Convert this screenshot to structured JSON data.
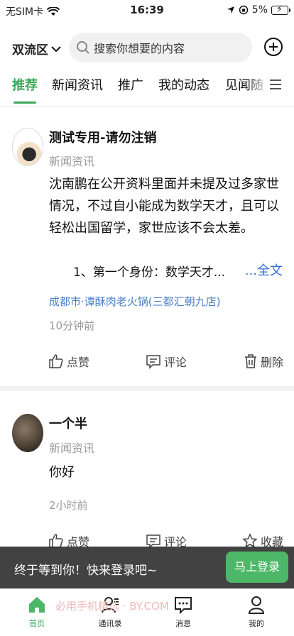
{
  "status_bar": {
    "carrier": "无SIM卡",
    "time": "16:39",
    "battery": "5%"
  },
  "top": {
    "district": "双流区",
    "search_placeholder": "搜索你想要的内容"
  },
  "tabs": [
    {
      "label": "推荐"
    },
    {
      "label": "新闻资讯"
    },
    {
      "label": "推广"
    },
    {
      "label": "我的动态"
    },
    {
      "label": "见闻随"
    }
  ],
  "posts": [
    {
      "author": "测试专用-请勿注销",
      "source": "新闻资讯",
      "content": "沈南鹏在公开资料里面并未提及过多家世情况，不过自小能成为数学天才，且可以轻松出国留学，家世应该不会太差。",
      "indent_line": "1、第一个身份：数学天才...",
      "full_text": "...全文",
      "location": "成都市·谭酥肉老火锅(三都汇朝九店)",
      "time": "10分钟前",
      "actions": {
        "like": "点赞",
        "comment": "评论",
        "third": "删除"
      }
    },
    {
      "author": "一个半",
      "source": "新闻资讯",
      "content": "你好",
      "time": "2小时前",
      "actions": {
        "like": "点赞",
        "comment": "评论",
        "third": "收藏"
      }
    }
  ],
  "login_banner": {
    "text": "终于等到你！快来登录吧~",
    "button": "马上登录"
  },
  "bottom_nav": [
    {
      "label": "首页"
    },
    {
      "label": "通讯录"
    },
    {
      "label": "消息"
    },
    {
      "label": "我的"
    }
  ],
  "watermark": "必用手机精选 · BY.COM",
  "colors": {
    "accent": "#3aa757",
    "link": "#2f6fd1",
    "location": "#4a7fc8"
  }
}
